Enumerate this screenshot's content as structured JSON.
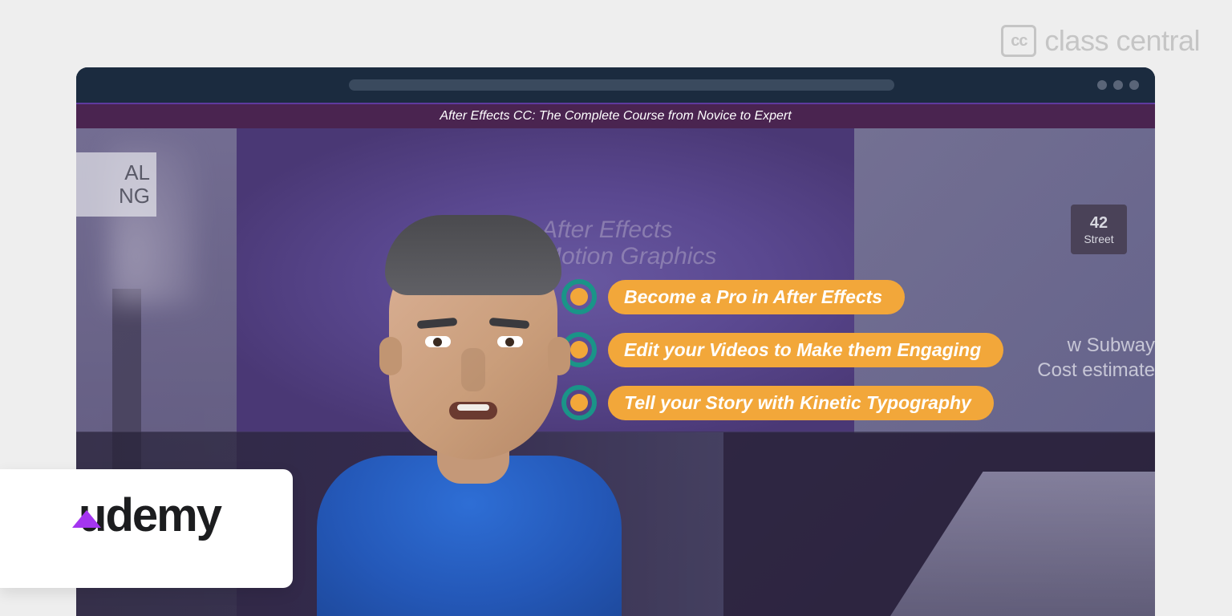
{
  "brand": {
    "classcentral_icon": "cc",
    "classcentral_text": "class central",
    "udemy_text": "udemy"
  },
  "course": {
    "title": "After Effects CC: The Complete Course from Novice to Expert"
  },
  "background": {
    "left_label_line1": "AL",
    "left_label_line2": "NG",
    "center_line1": "After Effects",
    "center_line2": "Motion Graphics",
    "sign_42_num": "42",
    "sign_42_sub": "Street",
    "subway_line1": "w Subway",
    "subway_line2": "Cost estimate"
  },
  "bullets": [
    "Become a Pro in After Effects",
    "Edit your Videos to Make them Engaging",
    "Tell your Story with Kinetic Typography"
  ]
}
